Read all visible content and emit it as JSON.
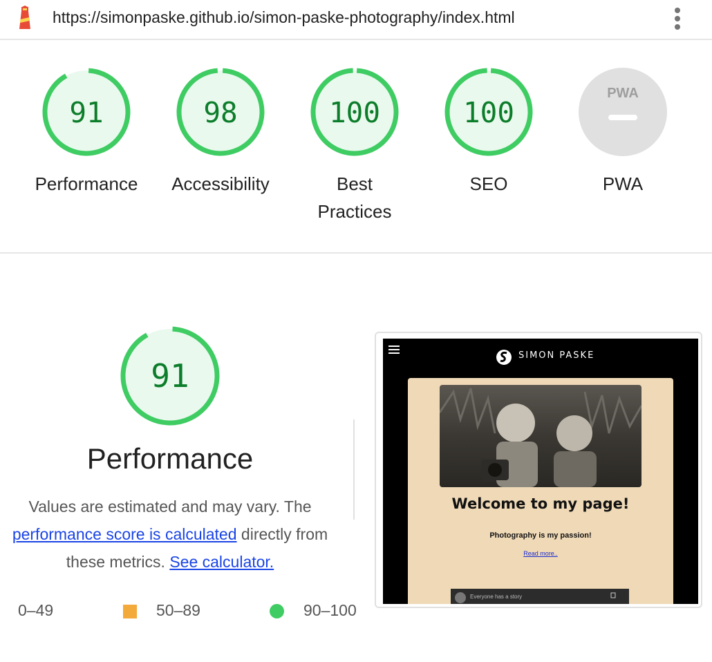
{
  "topbar": {
    "url": "https://simonpaske.github.io/simon-paske-photography/index.html",
    "logo_icon": "lighthouse-icon",
    "menu_icon": "kebab-menu-icon"
  },
  "scores": [
    {
      "label": "Performance",
      "value": "91",
      "fraction": 0.91
    },
    {
      "label": "Accessibility",
      "value": "98",
      "fraction": 0.98
    },
    {
      "label": "Best\nPractices",
      "value": "100",
      "fraction": 1.0
    },
    {
      "label": "SEO",
      "value": "100",
      "fraction": 1.0
    }
  ],
  "pwa": {
    "label": "PWA",
    "badge": "PWA"
  },
  "performance": {
    "score": "91",
    "fraction": 0.91,
    "title": "Performance",
    "desc_prefix": "Values are estimated and may vary. The",
    "link_score": "performance score is calculated",
    "desc_mid": "directly from these metrics.",
    "link_calc": "See calculator."
  },
  "legend": {
    "fail": "0–49",
    "average": "50–89",
    "pass": "90–100"
  },
  "screenshot": {
    "brand": "SIMON PASKE",
    "welcome": "Welcome to my page!",
    "passion": "Photography is my passion!",
    "read_more": "Read more..",
    "video_text": "Everyone has a story"
  },
  "colors": {
    "pass": "#0c7d2a",
    "pass_ring": "#3fcc63",
    "pass_bg": "#eaf9ee",
    "average": "#f4a93b",
    "link": "#1a44e6",
    "pwa_bg": "#e0e0e0"
  }
}
